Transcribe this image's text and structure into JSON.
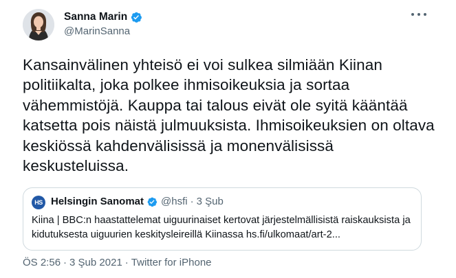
{
  "author": {
    "display_name": "Sanna Marin",
    "handle": "@MarinSanna",
    "verified_icon": "verified-badge-icon",
    "avatar_icon": "profile-avatar"
  },
  "more_icon": "more-options-icon",
  "tweet_text": "Kansainvälinen yhteisö ei voi sulkea silmiään Kiinan politiikalta, joka polkee ihmisoikeuksia ja sortaa vähemmistöjä. Kauppa tai talous eivät ole syitä kääntää katsetta pois näistä julmuuksista. Ihmisoikeuksien on oltava keskiössä kahdenvälisissä ja monenvälisissä keskusteluissa.",
  "quoted_tweet": {
    "avatar_text": "HS",
    "display_name": "Helsingin Sanomat",
    "handle": "@hsfi",
    "separator": "·",
    "date": "3 Şub",
    "text": "Kiina | BBC:n haastattelemat uiguurinaiset kertovat järjestelmällisistä raiskauksista ja kidutuksesta uiguurien keskitysleireillä Kiinassa hs.fi/ulkomaat/art-2..."
  },
  "meta": {
    "time": "ÖS 2:56",
    "separator": "·",
    "date": "3 Şub 2021",
    "source": "Twitter for iPhone"
  },
  "colors": {
    "verified": "#1d9bf0",
    "secondary_text": "#536471",
    "border": "#cfd9de",
    "hs_brand": "#2158a6"
  }
}
